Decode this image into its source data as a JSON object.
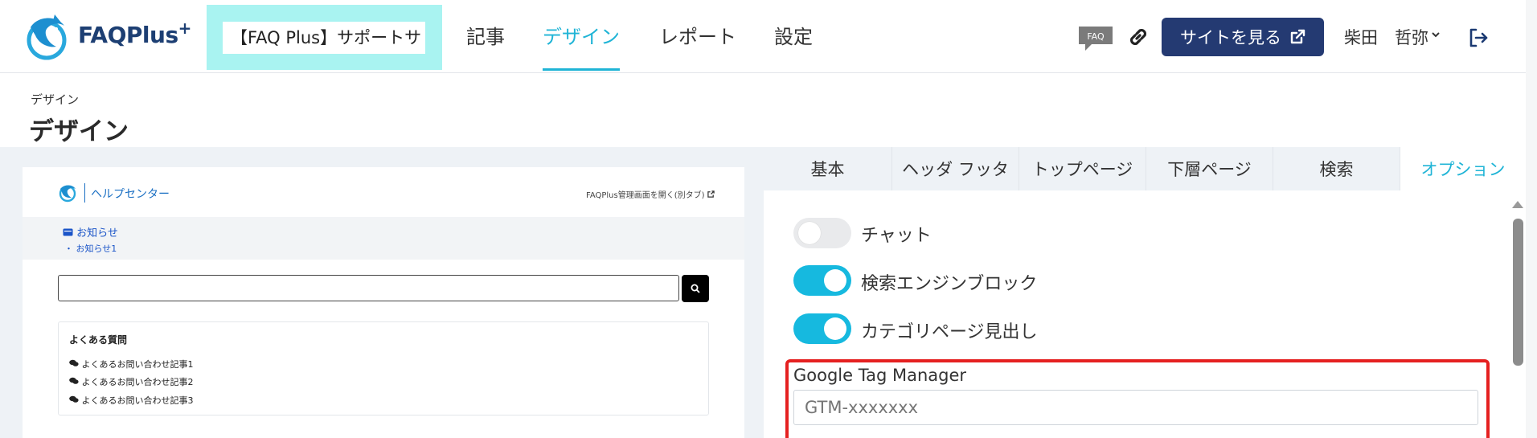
{
  "header": {
    "logo_text": "FAQPlus",
    "logo_sup": "+",
    "site_selector": "【FAQ Plus】サポートサ",
    "nav": [
      "記事",
      "デザイン",
      "レポート",
      "設定"
    ],
    "faq_badge": "FAQ",
    "view_site_label": "サイトを見る",
    "user_name": "柴田　哲弥"
  },
  "page": {
    "breadcrumb": "デザイン",
    "title": "デザイン"
  },
  "preview": {
    "brand": "ヘルプセンター",
    "admin_link": "FAQPlus管理画面を開く(別タブ)",
    "news_heading": "お知らせ",
    "news_item": "・ お知らせ1",
    "faq_title": "よくある質問",
    "faq_items": [
      "よくあるお問い合わせ記事1",
      "よくあるお問い合わせ記事2",
      "よくあるお問い合わせ記事3"
    ]
  },
  "settings": {
    "tabs": [
      "基本",
      "ヘッダ フッタ",
      "トップページ",
      "下層ページ",
      "検索",
      "オプション"
    ],
    "active_tab": "オプション",
    "toggles": [
      {
        "label": "チャット",
        "on": false
      },
      {
        "label": "検索エンジンブロック",
        "on": true
      },
      {
        "label": "カテゴリページ見出し",
        "on": true
      }
    ],
    "gtm_label": "Google Tag Manager",
    "gtm_placeholder": "GTM-xxxxxxx"
  },
  "colors": {
    "accent": "#1fb4d6",
    "primary_button": "#243a72",
    "site_box": "#a9f3f1",
    "highlight": "#e52020"
  }
}
